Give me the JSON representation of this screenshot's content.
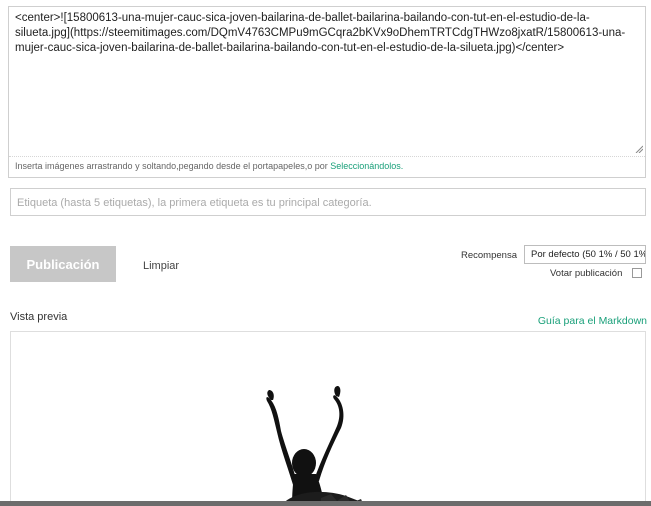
{
  "editor": {
    "body_text": "<center>![15800613-una-mujer-cauc-sica-joven-bailarina-de-ballet-bailarina-bailando-con-tut-en-el-estudio-de-la-silueta.jpg](https://steemitimages.com/DQmV4763CMPu9mGCqra2bKVx9oDhemTRTCdgTHWzo8jxatR/15800613-una-mujer-cauc-sica-joven-bailarina-de-ballet-bailarina-bailando-con-tut-en-el-estudio-de-la-silueta.jpg)</center>",
    "dropzone_prefix": "Inserta imágenes arrastrando y soltando,pegando desde el portapapeles,o por ",
    "dropzone_link": "Seleccionándolos."
  },
  "tags": {
    "placeholder": "Etiqueta (hasta 5 etiquetas), la primera etiqueta es tu principal categoría."
  },
  "actions": {
    "publish_label": "Publicación",
    "clear_label": "Limpiar"
  },
  "reward": {
    "label": "Recompensa",
    "selected": "Por defecto (50 1% / 50 1%"
  },
  "vote": {
    "label": "Votar publicación"
  },
  "preview": {
    "title": "Vista previa",
    "markdown_guide": "Guía para el Markdown"
  },
  "colors": {
    "accent": "#1aa07a",
    "button_disabled": "#c7c7c7"
  }
}
